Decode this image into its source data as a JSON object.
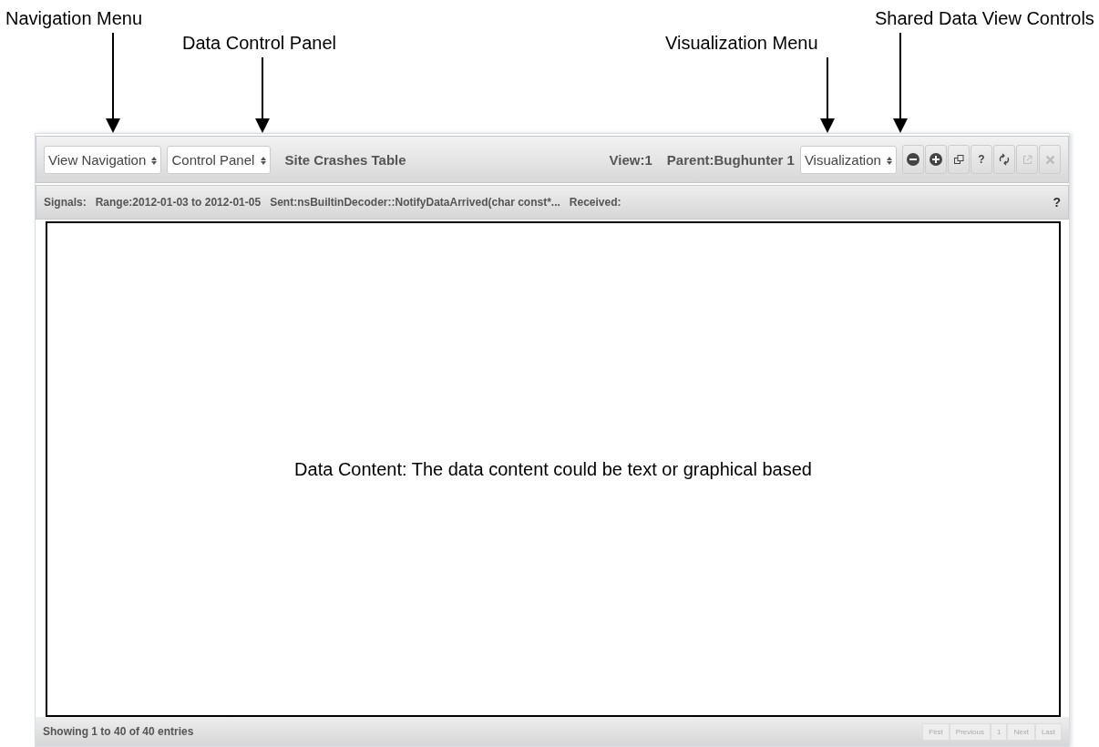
{
  "callouts": [
    {
      "label": "Navigation Menu"
    },
    {
      "label": "Data Control Panel"
    },
    {
      "label": "Visualization Menu"
    },
    {
      "label": "Shared Data View Controls"
    }
  ],
  "toolbar": {
    "selects": [
      {
        "value": "View Navigation"
      },
      {
        "value": "Control Panel"
      }
    ],
    "title": "Site Crashes Table",
    "view": "View:1",
    "parent": "Parent:Bughunter 1",
    "visualization": {
      "value": "Visualization"
    },
    "buttons": [
      {
        "kind": "minus",
        "disabled": false
      },
      {
        "kind": "plus",
        "disabled": false
      },
      {
        "kind": "windows",
        "disabled": false
      },
      {
        "kind": "help",
        "text": "?",
        "disabled": false
      },
      {
        "kind": "refresh",
        "disabled": false
      },
      {
        "kind": "external",
        "disabled": true
      },
      {
        "kind": "close",
        "disabled": true
      }
    ]
  },
  "signals": {
    "label": "Signals:",
    "range": "Range:2012-01-03 to 2012-01-05",
    "sent": "Sent:nsBuiltinDecoder::NotifyDataArrived(char const*...",
    "received": "Received:",
    "help": "?"
  },
  "content": {
    "text": "Data Content: The data content could be text or graphical based"
  },
  "footer": {
    "info": "Showing 1 to 40 of 40 entries",
    "pager": [
      {
        "label": "First"
      },
      {
        "label": "Previous"
      },
      {
        "label": "1"
      },
      {
        "label": "Next"
      },
      {
        "label": "Last"
      }
    ]
  }
}
